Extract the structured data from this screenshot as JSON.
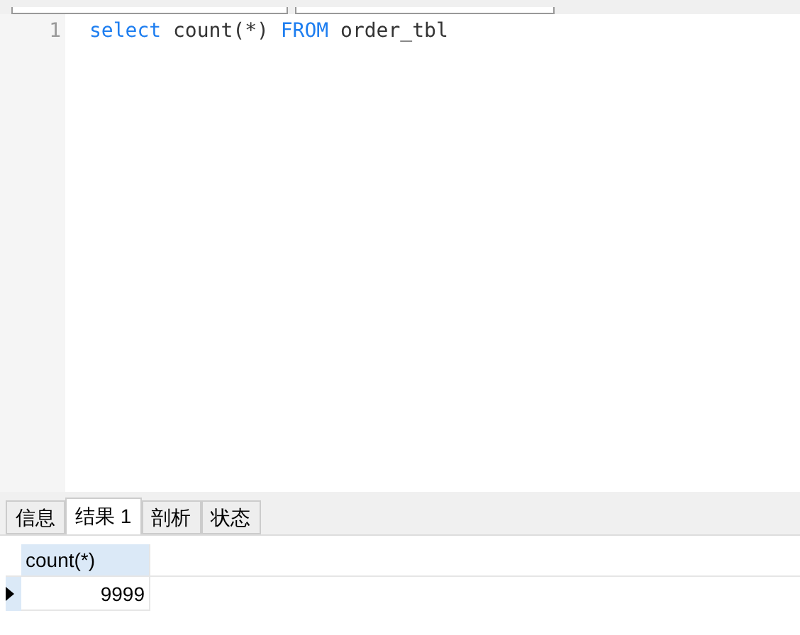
{
  "editor": {
    "lines": [
      {
        "number": "1",
        "tokens": [
          {
            "kind": "keyword",
            "text": "select"
          },
          {
            "kind": "plain",
            "text": " count(*) "
          },
          {
            "kind": "keyword",
            "text": "FROM"
          },
          {
            "kind": "plain",
            "text": " order_tbl"
          }
        ]
      }
    ]
  },
  "tabs": [
    {
      "label": "信息",
      "selected": false
    },
    {
      "label": "结果 1",
      "selected": true
    },
    {
      "label": "剖析",
      "selected": false
    },
    {
      "label": "状态",
      "selected": false
    }
  ],
  "result": {
    "columns": [
      "count(*)"
    ],
    "rows": [
      {
        "current": true,
        "cells": [
          "9999"
        ]
      }
    ]
  }
}
